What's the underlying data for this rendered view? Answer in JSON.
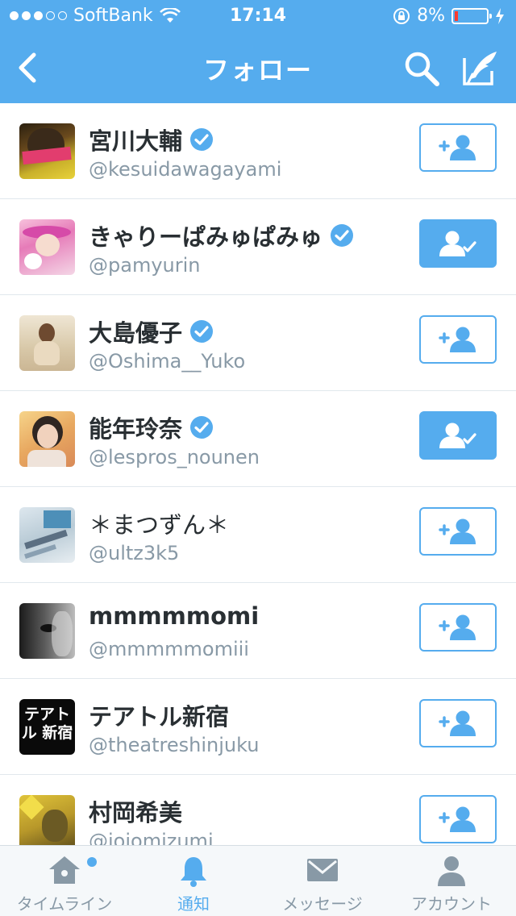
{
  "status_bar": {
    "carrier": "SoftBank",
    "signal_dots": 5,
    "signal_filled": 3,
    "time": "17:14",
    "battery": "8%",
    "battery_level": 0.08
  },
  "nav": {
    "title": "フォロー",
    "back_icon": "chevron-left-icon",
    "search_icon": "search-icon",
    "compose_icon": "compose-icon"
  },
  "users": [
    {
      "name": "宮川大輔",
      "handle": "@kesuidawagayami",
      "verified": true,
      "following": false
    },
    {
      "name": "きゃりーぱみゅぱみゅ",
      "handle": "@pamyurin",
      "verified": true,
      "following": true
    },
    {
      "name": "大島優子",
      "handle": "@Oshima__Yuko",
      "verified": true,
      "following": false
    },
    {
      "name": "能年玲奈",
      "handle": "@lespros_nounen",
      "verified": true,
      "following": true
    },
    {
      "name": "＊まつずん＊",
      "handle": "@ultz3k5",
      "verified": false,
      "following": false
    },
    {
      "name": "mmmmmomi",
      "handle": "@mmmmmomiii",
      "verified": false,
      "following": false
    },
    {
      "name": "テアトル新宿",
      "handle": "@theatreshinjuku",
      "verified": false,
      "following": false,
      "avatar_text": "テアトル 新宿"
    },
    {
      "name": "村岡希美",
      "handle": "@jojomizumi",
      "verified": false,
      "following": false
    }
  ],
  "tabs": [
    {
      "label": "タイムライン",
      "icon": "home-icon",
      "active": false,
      "badge": true
    },
    {
      "label": "通知",
      "icon": "bell-icon",
      "active": true
    },
    {
      "label": "メッセージ",
      "icon": "envelope-icon",
      "active": false
    },
    {
      "label": "アカウント",
      "icon": "person-icon",
      "active": false
    }
  ],
  "colors": {
    "brand": "#55acee",
    "text": "#292f33",
    "secondary": "#8899a6",
    "battery_low": "#ff3b30"
  }
}
